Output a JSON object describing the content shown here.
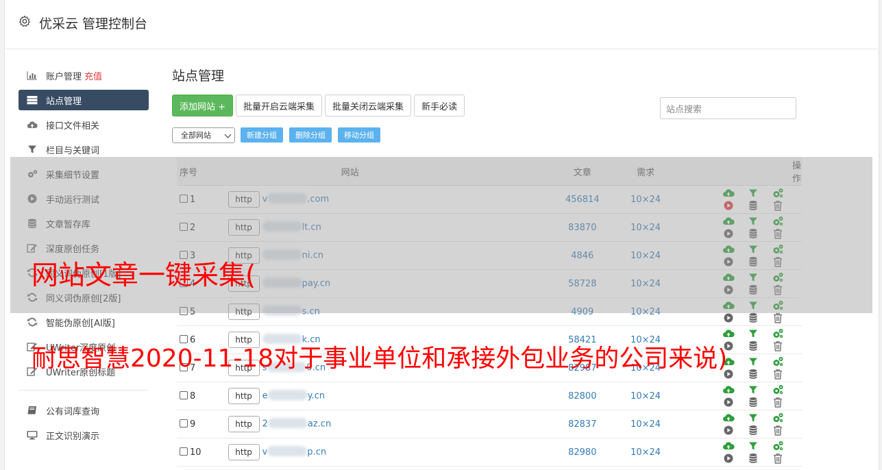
{
  "header": {
    "title": "优采云 管理控制台"
  },
  "sidebar": {
    "items": [
      {
        "label": "账户管理",
        "extra": "充值",
        "icon": "bar-chart-icon"
      },
      {
        "label": "站点管理",
        "icon": "server-icon"
      },
      {
        "label": "接口文件相关",
        "icon": "cloud-upload-icon"
      },
      {
        "label": "栏目与关键词",
        "icon": "filter-icon"
      },
      {
        "label": "采集细节设置",
        "icon": "cogs-icon"
      },
      {
        "label": "手动运行测试",
        "icon": "play-circle-icon"
      },
      {
        "label": "文章暂存库",
        "icon": "database-icon"
      },
      {
        "label": "深度原创任务",
        "icon": "edit-icon"
      },
      {
        "label": "同义词伪原创[1版]",
        "icon": "refresh-icon"
      },
      {
        "label": "同义词伪原创[2版]",
        "icon": "refresh-icon"
      },
      {
        "label": "智能伪原创[AI版]",
        "icon": "refresh-icon"
      },
      {
        "label": "UWriter深度原创",
        "icon": "edit-icon"
      },
      {
        "label": "UWriter原创标题",
        "icon": "edit-icon"
      },
      {
        "label": "公有词库查询",
        "icon": "book-icon"
      },
      {
        "label": "正文识别演示",
        "icon": "monitor-icon"
      }
    ]
  },
  "main": {
    "title": "站点管理",
    "buttons": {
      "add": "添加网站 +",
      "batch_on": "批量开启云端采集",
      "batch_off": "批量关闭云端采集",
      "guide": "新手必读"
    },
    "search_placeholder": "站点搜索",
    "group_select": "全部网站",
    "group_buttons": {
      "new": "新建分组",
      "delete": "删除分组",
      "move": "移动分组"
    },
    "table": {
      "headers": {
        "no": "序号",
        "site": "网站",
        "articles": "文章",
        "demand": "需求",
        "ops": "操作"
      },
      "rows": [
        {
          "no": "1",
          "proto": "http",
          "prefix": "v",
          "domain": ".com",
          "articles": "456814",
          "demand": "10×24",
          "play_red": true
        },
        {
          "no": "2",
          "proto": "http",
          "prefix": "",
          "domain": "lt.cn",
          "articles": "83870",
          "demand": "10×24",
          "play_red": false
        },
        {
          "no": "3",
          "proto": "http",
          "prefix": "",
          "domain": "ni.cn",
          "articles": "4846",
          "demand": "10×24",
          "play_red": false
        },
        {
          "no": "4",
          "proto": "http",
          "prefix": "",
          "domain": "pay.cn",
          "articles": "58728",
          "demand": "10×24",
          "play_red": false
        },
        {
          "no": "5",
          "proto": "http",
          "prefix": "",
          "domain": "s.cn",
          "articles": "4909",
          "demand": "10×24",
          "play_red": false
        },
        {
          "no": "6",
          "proto": "http",
          "prefix": "",
          "domain": "k.cn",
          "articles": "58421",
          "demand": "10×24",
          "play_red": false
        },
        {
          "no": "7",
          "proto": "http",
          "prefix": "s",
          "domain": "9.cn",
          "articles": "82987",
          "demand": "10×24",
          "play_red": false
        },
        {
          "no": "8",
          "proto": "http",
          "prefix": "e",
          "domain": "y.cn",
          "articles": "82800",
          "demand": "10×24",
          "play_red": false
        },
        {
          "no": "9",
          "proto": "http",
          "prefix": "2",
          "domain": "az.cn",
          "articles": "82837",
          "demand": "10×24",
          "play_red": false
        },
        {
          "no": "10",
          "proto": "http",
          "prefix": "v",
          "domain": "p.cn",
          "articles": "82980",
          "demand": "10×24",
          "play_red": false
        }
      ]
    }
  },
  "overlay": {
    "line1": "网站文章一键采集(",
    "line2": "耐思智慧2020-11-18对于事业单位和承接外包业务的公司来说)"
  },
  "colors": {
    "sidebar_active": "#374b63",
    "green": "#5cb85c",
    "blue_btn": "#5bb2ee",
    "link": "#337ab7",
    "charge": "#e4393c",
    "overlay_text": "#ff0000"
  }
}
